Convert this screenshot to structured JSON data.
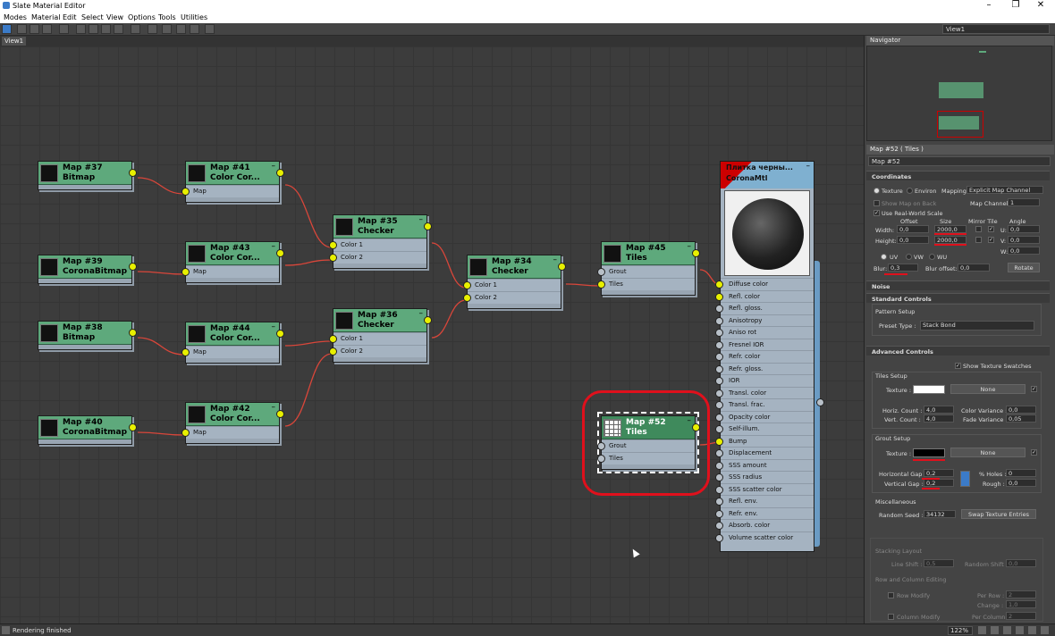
{
  "window": {
    "title": "Slate Material Editor",
    "min": "–",
    "max": "❐",
    "close": "✕"
  },
  "menu": [
    "Modes",
    "Material",
    "Edit",
    "Select",
    "View",
    "Options",
    "Tools",
    "Utilities"
  ],
  "view_select": "View1",
  "tab": "View1",
  "nodes": {
    "m37": {
      "name": "Map #37",
      "type": "Bitmap"
    },
    "m39": {
      "name": "Map #39",
      "type": "CoronaBitmap"
    },
    "m38": {
      "name": "Map #38",
      "type": "Bitmap"
    },
    "m40": {
      "name": "Map #40",
      "type": "CoronaBitmap"
    },
    "m41": {
      "name": "Map #41",
      "type": "Color Cor...",
      "slot": "Map"
    },
    "m43": {
      "name": "Map #43",
      "type": "Color Cor...",
      "slot": "Map"
    },
    "m44": {
      "name": "Map #44",
      "type": "Color Cor...",
      "slot": "Map"
    },
    "m42": {
      "name": "Map #42",
      "type": "Color Cor...",
      "slot": "Map"
    },
    "m35": {
      "name": "Map #35",
      "type": "Checker",
      "slots": [
        "Color 1",
        "Color 2"
      ]
    },
    "m36": {
      "name": "Map #36",
      "type": "Checker",
      "slots": [
        "Color 1",
        "Color 2"
      ]
    },
    "m34": {
      "name": "Map #34",
      "type": "Checker",
      "slots": [
        "Color 1",
        "Color 2"
      ]
    },
    "m45": {
      "name": "Map #45",
      "type": "Tiles",
      "slots": [
        "Grout",
        "Tiles"
      ]
    },
    "m52": {
      "name": "Map #52",
      "type": "Tiles",
      "slots": [
        "Grout",
        "Tiles"
      ]
    },
    "collapse": "–"
  },
  "material": {
    "name": "Плитка черны...",
    "type": "CoronaMtl",
    "slots": [
      "Diffuse color",
      "Refl. color",
      "Refl. gloss.",
      "Anisotropy",
      "Aniso rot",
      "Fresnel IOR",
      "Refr. color",
      "Refr. gloss.",
      "IOR",
      "Transl. color",
      "Transl. frac.",
      "Opacity color",
      "Self-illum.",
      "Bump",
      "Displacement",
      "SSS amount",
      "SSS radius",
      "SSS scatter color",
      "Refl. env.",
      "Refr. env.",
      "Absorb. color",
      "Volume scatter color"
    ]
  },
  "status": {
    "text": "Rendering finished",
    "zoom": "122%"
  },
  "panel": {
    "navigator": "Navigator",
    "editor_title": "Map #52  ( Tiles )",
    "map_name": "Map #52",
    "coordinates": {
      "header": "Coordinates",
      "texture": "Texture",
      "environ": "Environ",
      "mapping_label": "Mapping:",
      "mapping": "Explicit Map Channel",
      "show_map_on_back": "Show Map on Back",
      "map_channel_label": "Map Channel:",
      "map_channel": "1",
      "use_real_world": "Use Real-World Scale",
      "offset": "Offset",
      "size": "Size",
      "mirror_tile": "Mirror Tile",
      "angle": "Angle",
      "width_label": "Width:",
      "width_offset": "0,0",
      "width_size": "2000,0",
      "height_label": "Height:",
      "height_offset": "0,0",
      "height_size": "2000,0",
      "u_label": "U:",
      "u_angle": "0,0",
      "v_label": "V:",
      "v_angle": "0,0",
      "w_label": "W:",
      "w_angle": "0,0",
      "uv": "UV",
      "vw": "VW",
      "wu": "WU",
      "blur_label": "Blur:",
      "blur": "0,3",
      "blur_offset_label": "Blur offset:",
      "blur_offset": "0,0",
      "rotate": "Rotate"
    },
    "noise": "Noise",
    "standard": {
      "header": "Standard Controls",
      "pattern_setup": "Pattern Setup",
      "preset_label": "Preset Type :",
      "preset": "Stack Bond"
    },
    "advanced": {
      "header": "Advanced Controls",
      "show_swatches": "Show Texture Swatches",
      "tiles_setup": "Tiles Setup",
      "texture_label": "Texture :",
      "none": "None",
      "horiz_count_label": "Horiz. Count :",
      "horiz_count": "4,0",
      "vert_count_label": "Vert. Count :",
      "vert_count": "4,0",
      "color_var_label": "Color Variance :",
      "color_var": "0,0",
      "fade_var_label": "Fade Variance :",
      "fade_var": "0,05",
      "grout_setup": "Grout Setup",
      "hgap_label": "Horizontal Gap :",
      "hgap": "0,2",
      "vgap_label": "Vertical Gap :",
      "vgap": "0,2",
      "holes_label": "% Holes :",
      "holes": "0",
      "rough_label": "Rough :",
      "rough": "0,0",
      "misc": "Miscellaneous",
      "seed_label": "Random Seed :",
      "seed": "34132",
      "swap": "Swap Texture Entries",
      "stacking": "Stacking Layout",
      "line_shift_label": "Line Shift :",
      "line_shift": "0,5",
      "random_shift_label": "Random Shift :",
      "random_shift": "0,0",
      "row_col": "Row and Column Editing",
      "row_modify": "Row Modify",
      "per_row_label": "Per Row :",
      "per_row": "2",
      "change_label": "Change :",
      "change": "1,0",
      "col_modify": "Column Modify",
      "per_col_label": "Per Column :",
      "per_col": "2"
    },
    "colors": {
      "tile_swatch": "#ffffff",
      "grout_swatch": "#000000"
    }
  }
}
